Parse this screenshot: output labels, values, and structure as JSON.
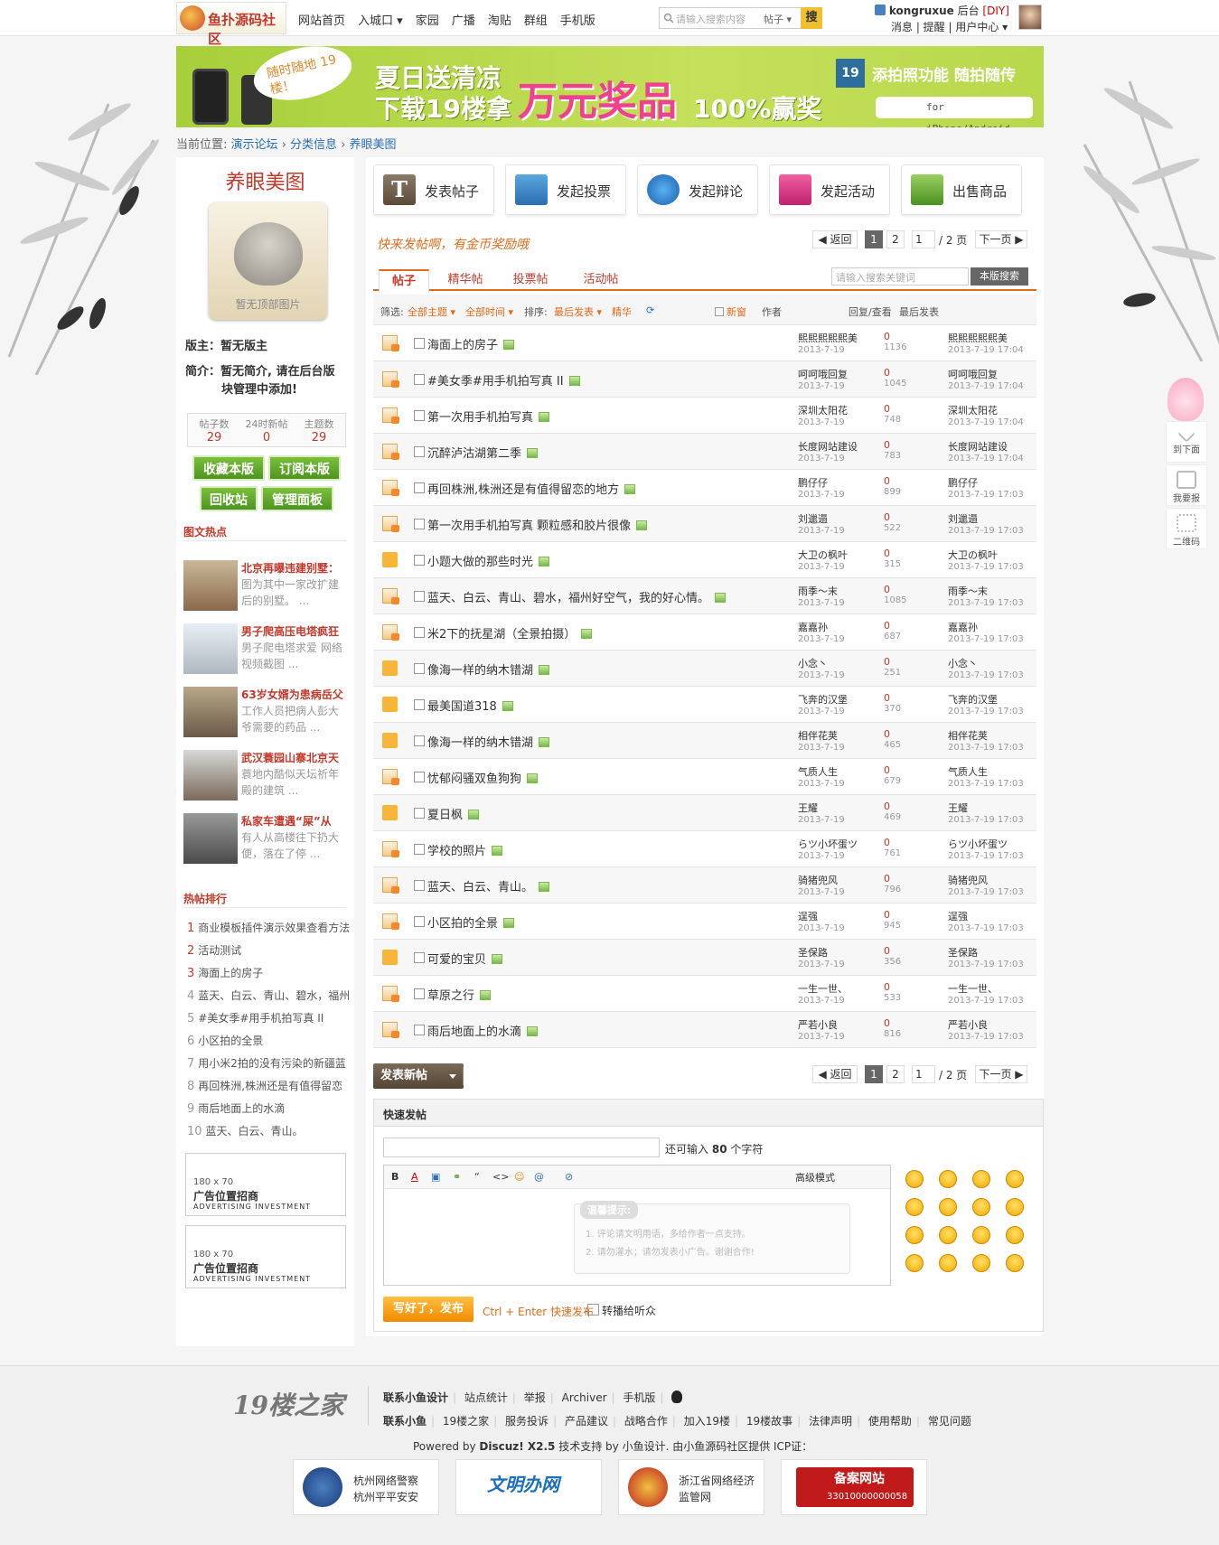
{
  "topbar": {
    "logo_text": "鱼扑源码社区",
    "nav": [
      {
        "label": "网站首页"
      },
      {
        "label": "入城口 ▾"
      },
      {
        "label": "家园"
      },
      {
        "label": "广播"
      },
      {
        "label": "淘贴"
      },
      {
        "label": "群组"
      },
      {
        "label": "手机版"
      }
    ],
    "search_placeholder": "请输入搜索内容",
    "search_type": "帖子 ▾",
    "search_button": "搜",
    "username": "kongruxue",
    "admin": "后台",
    "diy": "[DIY]",
    "user_links": "消息 | 提醒 | 用户中心 ▾"
  },
  "banner": {
    "bubble": "随时随地 19楼！",
    "line1": "夏日送清凉",
    "line2": "下载19楼拿",
    "big": "万元奖品",
    "pct": "100%赢奖",
    "badge": "19",
    "right_title": "添拍照功能 随拍随传",
    "right_sub": "for iPhone/Android"
  },
  "breadcrumb": {
    "prefix": "当前位置:",
    "items": [
      "演示论坛",
      "分类信息",
      "养眼美图"
    ],
    "sep": "›"
  },
  "sidebar": {
    "board_name": "养眼美图",
    "board_img_text": "暂无顶部图片",
    "moderator": "版主：暂无版主",
    "intro1": "简介：暂无简介, 请在后台版",
    "intro2": "块管理中添加!",
    "stats": [
      {
        "label": "帖子数",
        "value": "29"
      },
      {
        "label": "24时新帖",
        "value": "0"
      },
      {
        "label": "主题数",
        "value": "29"
      }
    ],
    "buttons": [
      "收藏本版",
      "订阅本版",
      "回收站",
      "管理面板"
    ],
    "hot_title": "图文热点",
    "hot": [
      {
        "title": "北京再曝违建别墅：",
        "desc": "图为其中一家改扩建后的别墅。 ..."
      },
      {
        "title": "男子爬高压电塔疯狂",
        "desc": "男子爬电塔求爱 网络视频截图 ..."
      },
      {
        "title": "63岁女婿为患病岳父",
        "desc": "工作人员把病人彭大爷需要的药品 ..."
      },
      {
        "title": "武汉蓑园山寨北京天",
        "desc": "      蓑地内酷似天坛祈年殿的建筑 ..."
      },
      {
        "title": "私家车遭遇“屎”从",
        "desc": "有人从高楼往下扔大便，落在了停 ..."
      }
    ],
    "rank_title": "热帖排行",
    "rank": [
      {
        "n": "1",
        "t": "商业模板插件演示效果查看方法"
      },
      {
        "n": "2",
        "t": "活动测试"
      },
      {
        "n": "3",
        "t": "海面上的房子"
      },
      {
        "n": "4",
        "t": "蓝天、白云、青山、碧水，福州"
      },
      {
        "n": "5",
        "t": "#美女季#用手机拍写真 II"
      },
      {
        "n": "6",
        "t": "小区拍的全景"
      },
      {
        "n": "7",
        "t": "用小米2拍的没有污染的新疆蓝"
      },
      {
        "n": "8",
        "t": "再回株洲,株洲还是有值得留恋"
      },
      {
        "n": "9",
        "t": "雨后地面上的水滴"
      },
      {
        "n": "10",
        "t": "蓝天、白云、青山。"
      }
    ],
    "ads": [
      {
        "size": "180 x 70",
        "title": "广告位置招商",
        "sub": "ADVERTISING INVESTMENT"
      },
      {
        "size": "180 x 70",
        "title": "广告位置招商",
        "sub": "ADVERTISING INVESTMENT"
      }
    ]
  },
  "main": {
    "post_buttons": [
      "发表帖子",
      "发起投票",
      "发起辩论",
      "发起活动",
      "出售商品"
    ],
    "slogan": "快来发帖啊，有金币奖励哦",
    "pager": {
      "back": "◀ 返回",
      "p1": "1",
      "p2": "2",
      "input": "1",
      "total": "/ 2 页",
      "next": "下一页 ▶"
    },
    "tabs": [
      "帖子",
      "精华帖",
      "投票帖",
      "活动帖"
    ],
    "kw_placeholder": "请输入搜索关键词",
    "kw_button": "本版搜索",
    "filter": {
      "label": "筛选:",
      "all_topics": "全部主题 ▾",
      "all_time": "全部时间 ▾",
      "sort_label": "排序:",
      "sort": "最后发表 ▾",
      "digest": "精华",
      "refresh": "⟳",
      "newwin": "新窗",
      "author": "作者",
      "replies": "回复/查看",
      "last": "最后发表"
    },
    "threads": [
      {
        "icon": "hot",
        "title": "海面上的房子",
        "author": "熙熙熙熙熙美",
        "date": "2013-7-19",
        "replies": "0",
        "views": "1136",
        "last_user": "熙熙熙熙熙美",
        "last_time": "2013-7-19 17:04"
      },
      {
        "icon": "hot",
        "title": "#美女季#用手机拍写真 II",
        "author": "呵呵哦回复",
        "date": "2013-7-19",
        "replies": "0",
        "views": "1045",
        "last_user": "呵呵哦回复",
        "last_time": "2013-7-19 17:04"
      },
      {
        "icon": "hot",
        "title": "第一次用手机拍写真",
        "author": "深圳太阳花",
        "date": "2013-7-19",
        "replies": "0",
        "views": "748",
        "last_user": "深圳太阳花",
        "last_time": "2013-7-19 17:04"
      },
      {
        "icon": "hot",
        "title": "沉醉泸沽湖第二季",
        "author": "长度网站建设",
        "date": "2013-7-19",
        "replies": "0",
        "views": "783",
        "last_user": "长度网站建设",
        "last_time": "2013-7-19 17:04"
      },
      {
        "icon": "hot",
        "title": "再回株洲,株洲还是有值得留恋的地方",
        "author": "鹏仔仔",
        "date": "2013-7-19",
        "replies": "0",
        "views": "899",
        "last_user": "鹏仔仔",
        "last_time": "2013-7-19 17:03"
      },
      {
        "icon": "hot",
        "title": "第一次用手机拍写真 颗粒感和胶片很像",
        "author": "刘邋遢",
        "date": "2013-7-19",
        "replies": "0",
        "views": "522",
        "last_user": "刘邋遢",
        "last_time": "2013-7-19 17:03"
      },
      {
        "icon": "fold",
        "title": "小题大做的那些时光",
        "author": "大卫の枫叶",
        "date": "2013-7-19",
        "replies": "0",
        "views": "315",
        "last_user": "大卫の枫叶",
        "last_time": "2013-7-19 17:03"
      },
      {
        "icon": "hot",
        "title": "蓝天、白云、青山、碧水，福州好空气，我的好心情。",
        "author": "雨季～末",
        "date": "2013-7-19",
        "replies": "0",
        "views": "1085",
        "last_user": "雨季～末",
        "last_time": "2013-7-19 17:03"
      },
      {
        "icon": "hot",
        "title": "米2下的抚星湖（全景拍摄）",
        "author": "嘉嘉孙",
        "date": "2013-7-19",
        "replies": "0",
        "views": "687",
        "last_user": "嘉嘉孙",
        "last_time": "2013-7-19 17:03"
      },
      {
        "icon": "fold",
        "title": "像海一样的纳木错湖",
        "author": "小念丶",
        "date": "2013-7-19",
        "replies": "0",
        "views": "251",
        "last_user": "小念丶",
        "last_time": "2013-7-19 17:03"
      },
      {
        "icon": "fold",
        "title": "最美国道318",
        "author": "飞奔的汉堡",
        "date": "2013-7-19",
        "replies": "0",
        "views": "370",
        "last_user": "飞奔的汉堡",
        "last_time": "2013-7-19 17:03"
      },
      {
        "icon": "fold",
        "title": "像海一样的纳木错湖",
        "author": "相伴花荚",
        "date": "2013-7-19",
        "replies": "0",
        "views": "465",
        "last_user": "相伴花荚",
        "last_time": "2013-7-19 17:03"
      },
      {
        "icon": "hot",
        "title": "忧郁闷骚双鱼狗狗",
        "author": "气质人生",
        "date": "2013-7-19",
        "replies": "0",
        "views": "679",
        "last_user": "气质人生",
        "last_time": "2013-7-19 17:03"
      },
      {
        "icon": "fold",
        "title": "夏日枫",
        "author": "王耀",
        "date": "2013-7-19",
        "replies": "0",
        "views": "469",
        "last_user": "王耀",
        "last_time": "2013-7-19 17:03"
      },
      {
        "icon": "hot",
        "title": "学校的照片",
        "author": "らツ小坏蛋ツ",
        "date": "2013-7-19",
        "replies": "0",
        "views": "761",
        "last_user": "らツ小坏蛋ツ",
        "last_time": "2013-7-19 17:03"
      },
      {
        "icon": "hot",
        "title": "蓝天、白云、青山。",
        "author": "骑猪兜风",
        "date": "2013-7-19",
        "replies": "0",
        "views": "796",
        "last_user": "骑猪兜风",
        "last_time": "2013-7-19 17:03"
      },
      {
        "icon": "hot",
        "title": "小区拍的全景",
        "author": "逞强",
        "date": "2013-7-19",
        "replies": "0",
        "views": "945",
        "last_user": "逞强",
        "last_time": "2013-7-19 17:03"
      },
      {
        "icon": "fold",
        "title": "可爱的宝贝",
        "author": "圣保路",
        "date": "2013-7-19",
        "replies": "0",
        "views": "356",
        "last_user": "圣保路",
        "last_time": "2013-7-19 17:03"
      },
      {
        "icon": "hot",
        "title": "草原之行",
        "author": "一生一世、",
        "date": "2013-7-19",
        "replies": "0",
        "views": "533",
        "last_user": "一生一世、",
        "last_time": "2013-7-19 17:03"
      },
      {
        "icon": "hot",
        "title": "雨后地面上的水滴",
        "author": "严若小良",
        "date": "2013-7-19",
        "replies": "0",
        "views": "816",
        "last_user": "严若小良",
        "last_time": "2013-7-19 17:03"
      }
    ],
    "new_post": "发表新帖",
    "quick": {
      "title": "快速发帖",
      "hint_pre": "还可输入",
      "hint_num": "80",
      "hint_post": "个字符",
      "toolbar": [
        "B",
        "A",
        "▣",
        "⚭",
        "“",
        "<>",
        "☺",
        "@",
        "⊘"
      ],
      "advanced": "高级模式",
      "tip_label": "温馨提示:",
      "tip1": "1. 评论请文明用语，多给作者一点支持。",
      "tip2": "2. 请勿灌水；请勿发表小广告。谢谢合作!",
      "submit": "写好了，发布",
      "ctrl": "Ctrl + Enter 快速发布",
      "broadcast": "转播给听众"
    }
  },
  "float": {
    "down": "到下面",
    "report": "我要报",
    "qr": "二维码"
  },
  "footer": {
    "logo": "19楼之家",
    "links1": [
      "联系小鱼设计",
      "站点统计",
      "举报",
      "Archiver",
      "手机版"
    ],
    "links2": [
      "联系小鱼",
      "19楼之家",
      "服务投诉",
      "产品建议",
      "战略合作",
      "加入19楼",
      "19楼故事",
      "法律声明",
      "使用帮助",
      "常见问题"
    ],
    "powered_pre": "Powered by ",
    "powered_b": "Discuz! X2.5",
    "powered_post": " 技术支持 by 小鱼设计. 由小鱼源码社区提供 ICP证：",
    "badges": [
      {
        "t1": "杭州网络警察",
        "t2": "杭州平平安安"
      },
      {
        "t1": "文明办网",
        "t2": ""
      },
      {
        "t1": "浙江省网络经济",
        "t2": "监管网"
      },
      {
        "t1": "备案网站",
        "t2": "33010000000058"
      }
    ]
  }
}
